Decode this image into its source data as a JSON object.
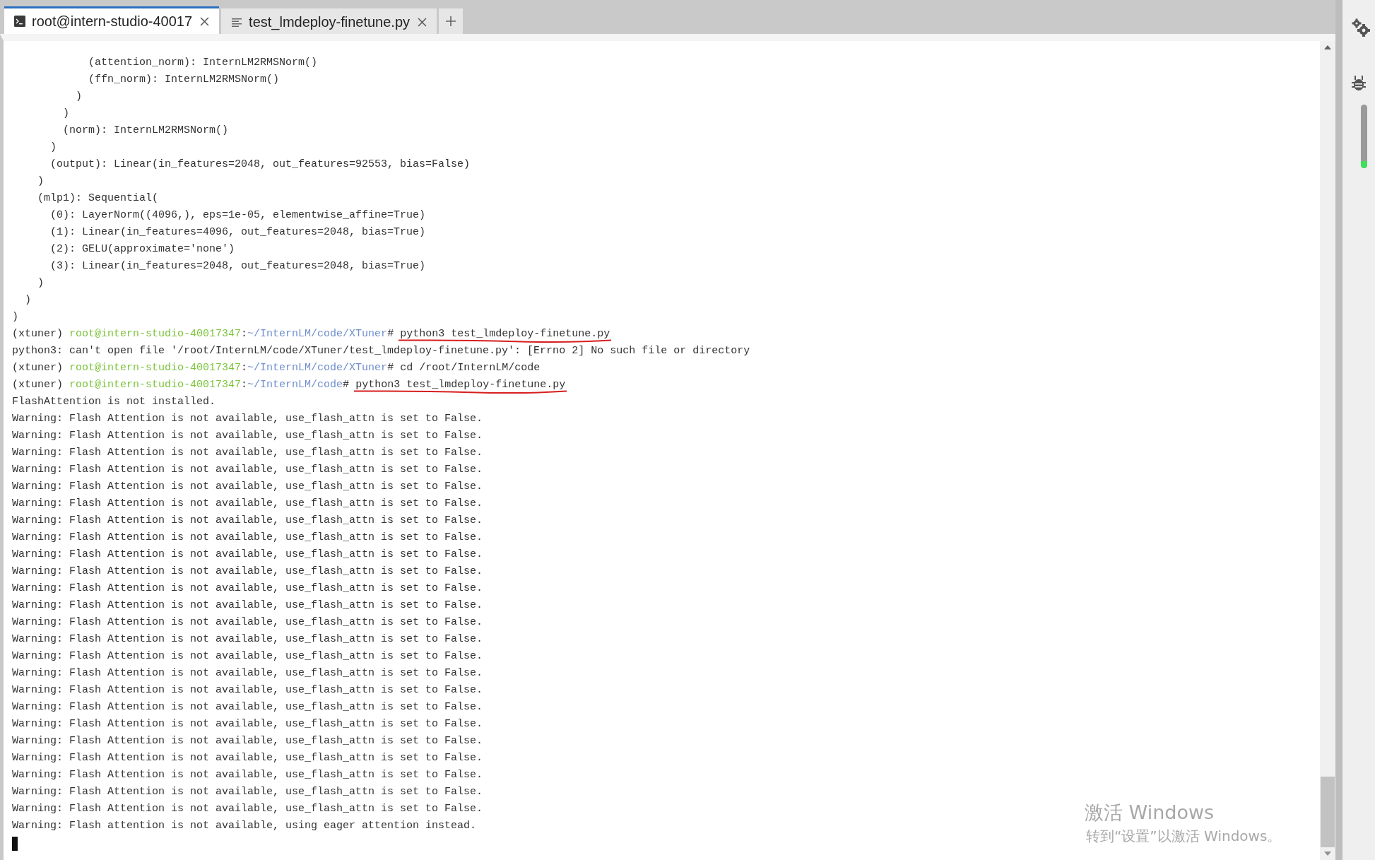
{
  "tabs": [
    {
      "label": "root@intern-studio-40017",
      "kind": "terminal",
      "selected": true
    },
    {
      "label": "test_lmdeploy-finetune.py",
      "kind": "file",
      "selected": false
    }
  ],
  "terminal": {
    "lines": [
      {
        "kind": "text",
        "text": "            (attention_norm): InternLM2RMSNorm()"
      },
      {
        "kind": "text",
        "text": "            (ffn_norm): InternLM2RMSNorm()"
      },
      {
        "kind": "text",
        "text": "          )"
      },
      {
        "kind": "text",
        "text": "        )"
      },
      {
        "kind": "text",
        "text": "        (norm): InternLM2RMSNorm()"
      },
      {
        "kind": "text",
        "text": "      )"
      },
      {
        "kind": "text",
        "text": "      (output): Linear(in_features=2048, out_features=92553, bias=False)"
      },
      {
        "kind": "text",
        "text": "    )"
      },
      {
        "kind": "text",
        "text": "    (mlp1): Sequential("
      },
      {
        "kind": "text",
        "text": "      (0): LayerNorm((4096,), eps=1e-05, elementwise_affine=True)"
      },
      {
        "kind": "text",
        "text": "      (1): Linear(in_features=4096, out_features=2048, bias=True)"
      },
      {
        "kind": "text",
        "text": "      (2): GELU(approximate='none')"
      },
      {
        "kind": "text",
        "text": "      (3): Linear(in_features=2048, out_features=2048, bias=True)"
      },
      {
        "kind": "text",
        "text": "    )"
      },
      {
        "kind": "text",
        "text": "  )"
      },
      {
        "kind": "text",
        "text": ")"
      },
      {
        "kind": "prompt",
        "env": "(xtuner) ",
        "user": "root@intern-studio-40017347",
        "sep": ":",
        "path": "~/InternLM/code/XTuner",
        "mark": "# ",
        "command": "python3 test_lmdeploy-finetune.py",
        "underlined": true
      },
      {
        "kind": "text",
        "text": "python3: can't open file '/root/InternLM/code/XTuner/test_lmdeploy-finetune.py': [Errno 2] No such file or directory"
      },
      {
        "kind": "prompt",
        "env": "(xtuner) ",
        "user": "root@intern-studio-40017347",
        "sep": ":",
        "path": "~/InternLM/code/XTuner",
        "mark": "# ",
        "command": "cd /root/InternLM/code",
        "underlined": false
      },
      {
        "kind": "prompt",
        "env": "(xtuner) ",
        "user": "root@intern-studio-40017347",
        "sep": ":",
        "path": "~/InternLM/code",
        "mark": "# ",
        "command": "python3 test_lmdeploy-finetune.py",
        "underlined": true
      },
      {
        "kind": "text",
        "text": "FlashAttention is not installed."
      },
      {
        "kind": "text",
        "text": "Warning: Flash Attention is not available, use_flash_attn is set to False."
      },
      {
        "kind": "text",
        "text": "Warning: Flash Attention is not available, use_flash_attn is set to False."
      },
      {
        "kind": "text",
        "text": "Warning: Flash Attention is not available, use_flash_attn is set to False."
      },
      {
        "kind": "text",
        "text": "Warning: Flash Attention is not available, use_flash_attn is set to False."
      },
      {
        "kind": "text",
        "text": "Warning: Flash Attention is not available, use_flash_attn is set to False."
      },
      {
        "kind": "text",
        "text": "Warning: Flash Attention is not available, use_flash_attn is set to False."
      },
      {
        "kind": "text",
        "text": "Warning: Flash Attention is not available, use_flash_attn is set to False."
      },
      {
        "kind": "text",
        "text": "Warning: Flash Attention is not available, use_flash_attn is set to False."
      },
      {
        "kind": "text",
        "text": "Warning: Flash Attention is not available, use_flash_attn is set to False."
      },
      {
        "kind": "text",
        "text": "Warning: Flash Attention is not available, use_flash_attn is set to False."
      },
      {
        "kind": "text",
        "text": "Warning: Flash Attention is not available, use_flash_attn is set to False."
      },
      {
        "kind": "text",
        "text": "Warning: Flash Attention is not available, use_flash_attn is set to False."
      },
      {
        "kind": "text",
        "text": "Warning: Flash Attention is not available, use_flash_attn is set to False."
      },
      {
        "kind": "text",
        "text": "Warning: Flash Attention is not available, use_flash_attn is set to False."
      },
      {
        "kind": "text",
        "text": "Warning: Flash Attention is not available, use_flash_attn is set to False."
      },
      {
        "kind": "text",
        "text": "Warning: Flash Attention is not available, use_flash_attn is set to False."
      },
      {
        "kind": "text",
        "text": "Warning: Flash Attention is not available, use_flash_attn is set to False."
      },
      {
        "kind": "text",
        "text": "Warning: Flash Attention is not available, use_flash_attn is set to False."
      },
      {
        "kind": "text",
        "text": "Warning: Flash Attention is not available, use_flash_attn is set to False."
      },
      {
        "kind": "text",
        "text": "Warning: Flash Attention is not available, use_flash_attn is set to False."
      },
      {
        "kind": "text",
        "text": "Warning: Flash Attention is not available, use_flash_attn is set to False."
      },
      {
        "kind": "text",
        "text": "Warning: Flash Attention is not available, use_flash_attn is set to False."
      },
      {
        "kind": "text",
        "text": "Warning: Flash Attention is not available, use_flash_attn is set to False."
      },
      {
        "kind": "text",
        "text": "Warning: Flash Attention is not available, use_flash_attn is set to False."
      },
      {
        "kind": "text",
        "text": "Warning: Flash attention is not available, using eager attention instead."
      }
    ]
  },
  "activation_notice": {
    "title": "激活 Windows",
    "subtitle": "转到“设置”以激活 Windows。"
  }
}
